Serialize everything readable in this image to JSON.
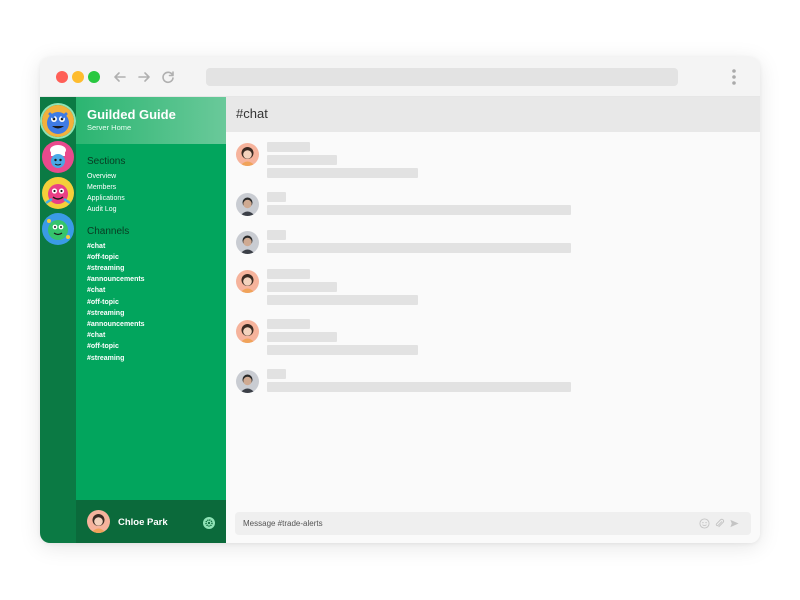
{
  "server": {
    "name": "Guilded Guide",
    "subtitle": "Server Home"
  },
  "sidebar": {
    "sections_title": "Sections",
    "sections": [
      "Overview",
      "Members",
      "Applications",
      "Audit Log"
    ],
    "channels_title": "Channels",
    "channels": [
      "#chat",
      "#off-topic",
      "#streaming",
      "#announcements",
      "#chat",
      "#off-topic",
      "#streaming",
      "#announcements",
      "#chat",
      "#off-topic",
      "#streaming"
    ]
  },
  "user": {
    "name": "Chloe Park"
  },
  "channel": {
    "title": "#chat"
  },
  "composer": {
    "placeholder": "Message #trade-alerts"
  },
  "server_icons": [
    "monster-server-icon",
    "chef-server-icon",
    "pink-creature-server-icon",
    "green-creature-server-icon"
  ],
  "messages": [
    {
      "author": "woman-avatar"
    },
    {
      "author": "man-avatar"
    },
    {
      "author": "man-avatar"
    },
    {
      "author": "woman-avatar"
    },
    {
      "author": "woman-avatar"
    },
    {
      "author": "man-avatar"
    }
  ],
  "colors": {
    "rail": "#0b7a44",
    "sidebar": "#02a55d",
    "user_bar": "#0b6a3b",
    "header": "#e8e8e8"
  }
}
